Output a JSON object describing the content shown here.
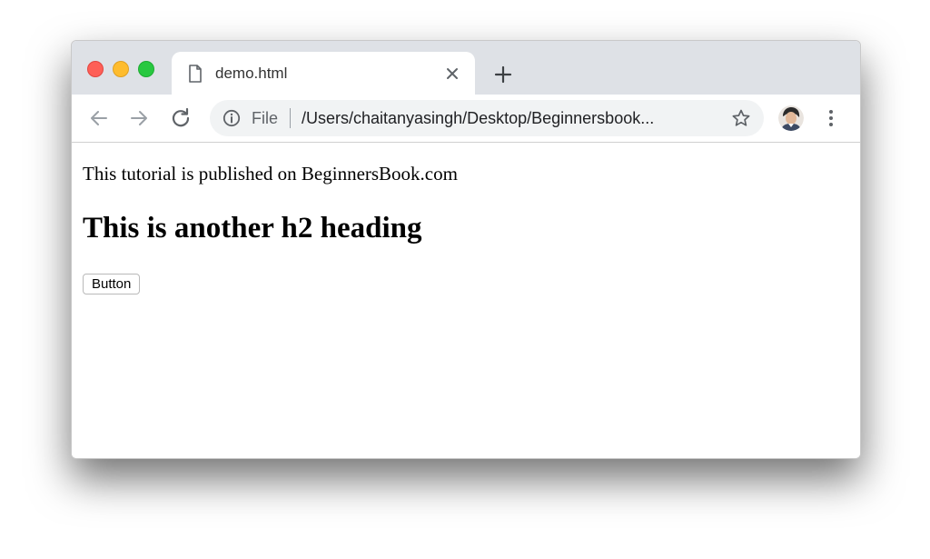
{
  "browser": {
    "tab": {
      "title": "demo.html",
      "icon": "document-icon",
      "close_icon": "close-icon"
    },
    "new_tab_icon": "plus-icon",
    "address_bar": {
      "scheme_label": "File",
      "url": "/Users/chaitanyasingh/Desktop/Beginnersbook..."
    },
    "icons": [
      "back-arrow-icon",
      "forward-arrow-icon",
      "reload-icon",
      "info-icon",
      "star-icon",
      "avatar",
      "more-vert-icon"
    ]
  },
  "page": {
    "paragraph": "This tutorial is published on BeginnersBook.com",
    "heading": "This is another h2 heading",
    "button_label": "Button"
  },
  "colors": {
    "traffic_red": "#fe5f57",
    "traffic_yellow": "#febc2e",
    "traffic_green": "#28c840",
    "tabstrip": "#dee1e6",
    "omnibox": "#f1f3f4"
  }
}
